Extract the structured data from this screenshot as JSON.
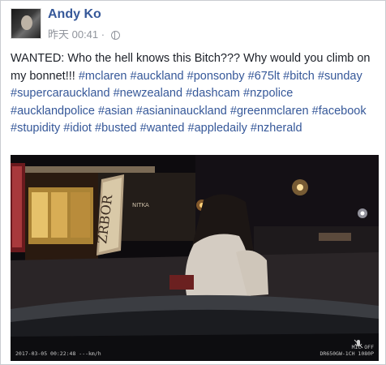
{
  "post": {
    "author": "Andy Ko",
    "timestamp": "昨天 00:41",
    "separator": "·",
    "privacy_icon": "globe-icon",
    "text_lead": "WANTED: Who the hell knows this Bitch??? Why would you climb on my bonnet!!! ",
    "hashtags": [
      "#mclaren",
      "#auckland",
      "#ponsonby",
      "#675lt",
      "#bitch",
      "#sunday",
      "#supercarauckland",
      "#newzealand",
      "#dashcam",
      "#nzpolice",
      "#aucklandpolice",
      "#asian",
      "#asianinauckland",
      "#greenmclaren",
      "#facebook",
      "#stupidity",
      "#idiot",
      "#busted",
      "#wanted",
      "#appledaily",
      "#nzherald"
    ]
  },
  "video": {
    "date_overlay": "2017-03-05 00:22:48",
    "speed_overlay": "---km/h",
    "mic_label": "MIC OFF",
    "device_overlay": "DR650GW-1CH 1080P",
    "storefront_sign": "NITKA",
    "banner_sign": "ZRBOR"
  },
  "colors": {
    "link": "#365899",
    "text": "#1d2129",
    "meta": "#90949c"
  }
}
